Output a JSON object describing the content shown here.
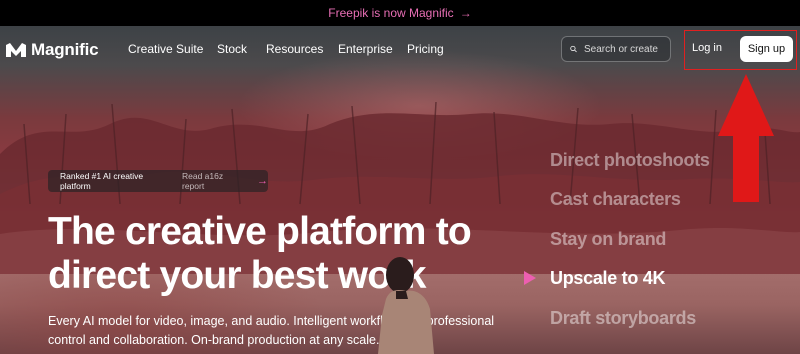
{
  "announcement": {
    "text": "Freepik is now Magnific",
    "arrow_icon": "arrow-right-icon",
    "color": "#e86fb5"
  },
  "nav": {
    "brand": "Magnific",
    "items": [
      "Creative Suite",
      "Stock",
      "Resources",
      "Enterprise",
      "Pricing"
    ],
    "search_placeholder": "Search or create",
    "login_label": "Log in",
    "signup_label": "Sign up"
  },
  "hero": {
    "badge": {
      "label": "Ranked #1 AI creative platform",
      "link": "Read a16z report"
    },
    "headline_line1": "The creative platform to",
    "headline_line2": "direct your best work",
    "subcopy_line1": "Every AI model for video, image, and audio. Intelligent workflows for professional",
    "subcopy_line2": "control and collaboration. On-brand production at any scale.",
    "rotator": [
      "Direct photoshoots",
      "Cast characters",
      "Stay on brand",
      "Upscale to 4K",
      "Draft storyboards"
    ],
    "active_index": 3
  },
  "annotation": {
    "color": "#e02020"
  },
  "accent_color": "#ec5fb0"
}
